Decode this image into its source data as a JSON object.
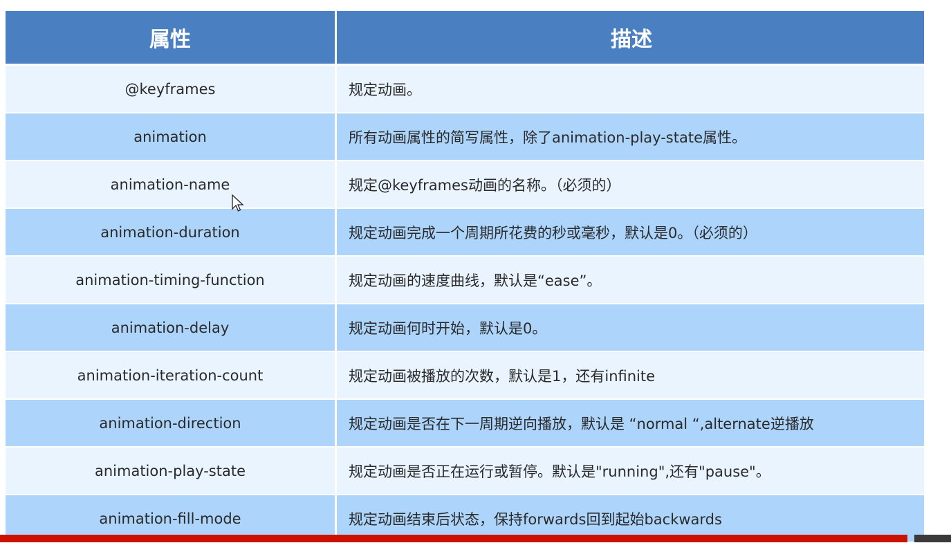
{
  "table": {
    "headers": [
      "属性",
      "描述"
    ],
    "rows": [
      {
        "property": "@keyframes",
        "description": "规定动画。"
      },
      {
        "property": "animation",
        "description": "所有动画属性的简写属性，除了animation-play-state属性。"
      },
      {
        "property": "animation-name",
        "description": "规定@keyframes动画的名称。（必须的）"
      },
      {
        "property": "animation-duration",
        "description": "规定动画完成一个周期所花费的秒或毫秒，默认是0。（必须的）"
      },
      {
        "property": "animation-timing-function",
        "description": "规定动画的速度曲线，默认是“ease”。"
      },
      {
        "property": "animation-delay",
        "description": "规定动画何时开始，默认是0。"
      },
      {
        "property": "animation-iteration-count",
        "description": "规定动画被播放的次数，默认是1，还有infinite"
      },
      {
        "property": "animation-direction",
        "description": "规定动画是否在下一周期逆向播放，默认是 “normal “,alternate逆播放"
      },
      {
        "property": "animation-play-state",
        "description": "规定动画是否正在运行或暂停。默认是\"running\",还有\"pause\"。"
      },
      {
        "property": "animation-fill-mode",
        "description": "规定动画结束后状态，保持forwards回到起始backwards"
      }
    ]
  },
  "colors": {
    "header": "#4a80c2",
    "row_light": "#e9f4fe",
    "row_dark": "#add4fb",
    "bottom_bar": "#cc1100"
  }
}
